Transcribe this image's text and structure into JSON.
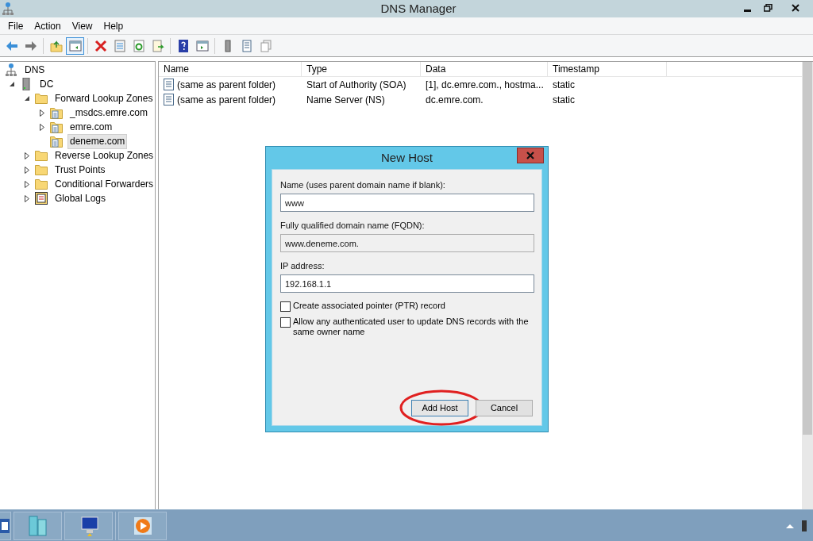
{
  "window": {
    "title": "DNS Manager"
  },
  "menu": [
    "File",
    "Action",
    "View",
    "Help"
  ],
  "tree": [
    {
      "label": "DNS",
      "kind": "dns",
      "selected": false,
      "children": [
        {
          "label": "DC",
          "kind": "server",
          "expanded": true,
          "selected": false,
          "children": [
            {
              "label": "Forward Lookup Zones",
              "kind": "folder",
              "expanded": true,
              "selected": false,
              "children": [
                {
                  "label": "_msdcs.emre.com",
                  "kind": "zone",
                  "expanded": false,
                  "selected": false
                },
                {
                  "label": "emre.com",
                  "kind": "zone",
                  "expanded": false,
                  "selected": false
                },
                {
                  "label": "deneme.com",
                  "kind": "zone",
                  "selected": true
                }
              ]
            },
            {
              "label": "Reverse Lookup Zones",
              "kind": "folder",
              "expanded": false,
              "selected": false
            },
            {
              "label": "Trust Points",
              "kind": "folder",
              "expanded": false,
              "selected": false
            },
            {
              "label": "Conditional Forwarders",
              "kind": "folder",
              "expanded": false,
              "selected": false
            },
            {
              "label": "Global Logs",
              "kind": "logs",
              "expanded": false,
              "selected": false
            }
          ]
        }
      ]
    }
  ],
  "table": {
    "columns": [
      "Name",
      "Type",
      "Data",
      "Timestamp"
    ],
    "rows": [
      [
        "(same as parent folder)",
        "Start of Authority (SOA)",
        "[1], dc.emre.com., hostma...",
        "static"
      ],
      [
        "(same as parent folder)",
        "Name Server (NS)",
        "dc.emre.com.",
        "static"
      ]
    ]
  },
  "dialog": {
    "title": "New Host",
    "fields": [
      {
        "label": "Name (uses parent domain name if blank):",
        "value": "www",
        "disabled": false
      },
      {
        "label": "Fully qualified domain name (FQDN):",
        "value": "www.deneme.com.",
        "disabled": true
      },
      {
        "label": "IP address:",
        "value": "192.168.1.1",
        "disabled": false
      }
    ],
    "checkboxes": [
      {
        "label": "Create associated pointer (PTR) record",
        "checked": false
      },
      {
        "label": "Allow any authenticated user to update DNS records with the same owner name",
        "checked": false
      }
    ],
    "buttons": [
      {
        "label": "Add Host",
        "highlighted": true
      },
      {
        "label": "Cancel",
        "highlighted": false
      }
    ]
  }
}
